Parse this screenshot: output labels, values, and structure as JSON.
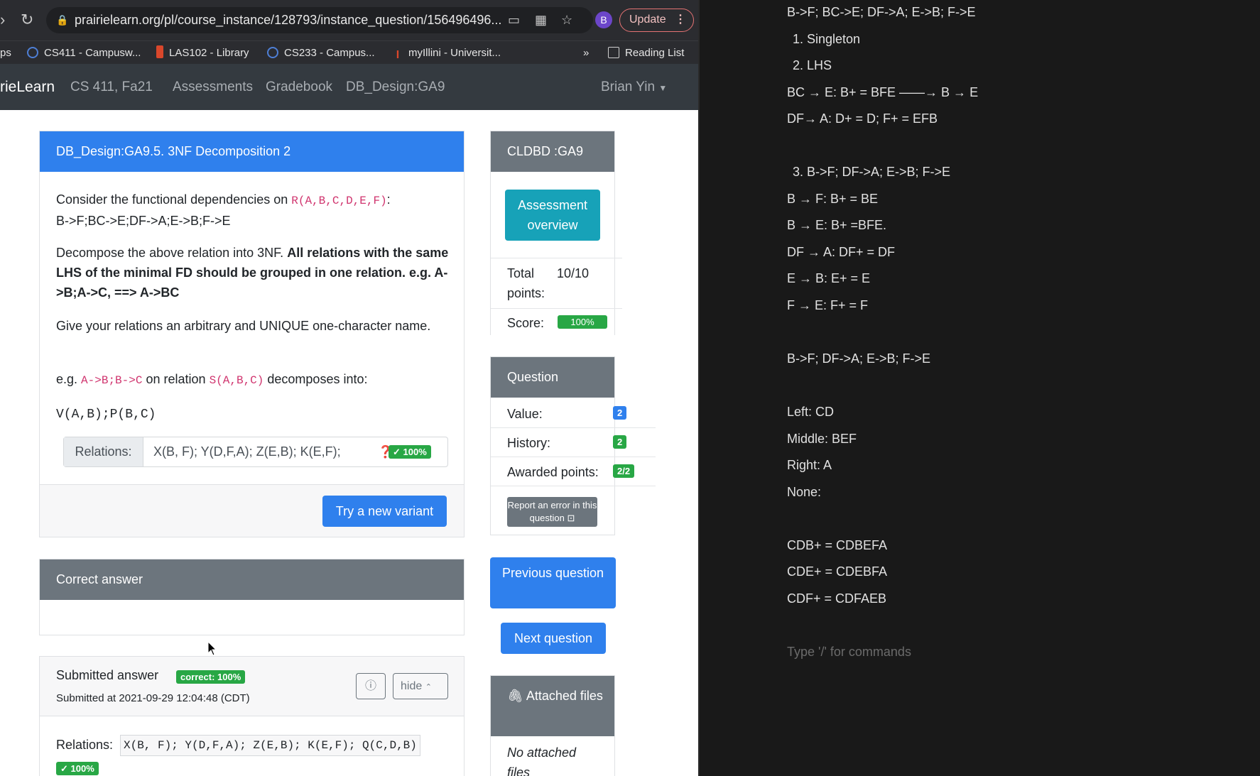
{
  "browser": {
    "url": "prairielearn.org/pl/course_instance/128793/instance_question/156496496...",
    "profile_initial": "B",
    "update_label": "Update",
    "bookmarks": [
      {
        "label": "ps",
        "icon": "apps-icon"
      },
      {
        "label": "CS411 - Campusw...",
        "icon": "campuswire-icon"
      },
      {
        "label": "LAS102 - Library",
        "icon": "library-icon"
      },
      {
        "label": "CS233 - Campus...",
        "icon": "campuswire-icon"
      },
      {
        "label": "myIllini - Universit...",
        "icon": "illinois-icon"
      }
    ],
    "bookmarks_overflow": "»",
    "reading_list": "Reading List"
  },
  "navbar": {
    "brand": "rieLearn",
    "course": "CS 411, Fa21",
    "links": [
      "Assessments",
      "Gradebook",
      "DB_Design:GA9"
    ],
    "user": "Brian Yin"
  },
  "question": {
    "title": "DB_Design:GA9.5. 3NF Decomposition 2",
    "intro_prefix": "Consider the functional dependencies on",
    "relation_expr": "R(A,B,C,D,E,F)",
    "intro_suffix": ":",
    "fds": "B->F;BC->E;DF->A;E->B;F->E",
    "decompose_plain": "Decompose the above relation into 3NF.",
    "decompose_bold": "All relations with the same LHS of the minimal FD should be grouped in one relation. e.g. A->B;A->C, ==> A->BC",
    "name_instruction": "Give your relations an arbitrary and UNIQUE one-character name.",
    "example_prefix": "e.g.",
    "example_fds": "A->B;B->C",
    "example_middle": "on relation",
    "example_relation": "S(A,B,C)",
    "example_suffix": "decomposes into:",
    "example_result": "V(A,B);P(B,C)",
    "relations_label": "Relations:",
    "relations_value": "X(B, F); Y(D,F,A); Z(E,B); K(E,F);",
    "score_badge": "100%",
    "new_variant": "Try a new variant"
  },
  "correct_answer": {
    "title": "Correct answer"
  },
  "submitted": {
    "title": "Submitted answer",
    "badge": "correct: 100%",
    "timestamp": "Submitted at 2021-09-29 12:04:48 (CDT)",
    "hide_label": "hide",
    "relations_label": "Relations:",
    "relations_value": "X(B, F); Y(D,F,A); Z(E,B); K(E,F); Q(C,D,B)",
    "score_badge": "100%"
  },
  "sidebar": {
    "assessment_title": "CLDBD :GA9",
    "overview_button": "Assessment overview",
    "total_points_label": "Total points:",
    "total_points_value": "10/10",
    "score_label": "Score:",
    "score_value": "100%",
    "question_title": "Question",
    "value_label": "Value:",
    "value_badge": "2",
    "history_label": "History:",
    "history_badge": "2",
    "awarded_label": "Awarded points:",
    "awarded_badge": "2/2",
    "report_error": "Report an error in this question",
    "previous_button": "Previous question",
    "next_button": "Next question",
    "attached_title": "Attached files",
    "no_files": "No attached files"
  },
  "notes": {
    "lines": [
      "B->F; BC->E; DF->A; E->B; F->E",
      "1.  Singleton",
      "2.  LHS",
      "BC → E: B+ = BFE ——→ B → E",
      "DF→ A: D+ = D; F+ = EFB",
      "3.  B->F; DF->A; E->B; F->E",
      "B → F: B+ = BE",
      "B → E: B+ =BFE.",
      "DF → A: DF+ = DF",
      "E → B: E+ = E",
      "F → E: F+ = F",
      "B->F; DF->A; E->B; F->E",
      "Left: CD",
      "Middle: BEF",
      "Right: A",
      "None:",
      "CDB+ = CDBEFA",
      "CDE+ = CDEBFA",
      "CDF+ = CDFAEB"
    ],
    "placeholder": "Type '/' for commands"
  }
}
